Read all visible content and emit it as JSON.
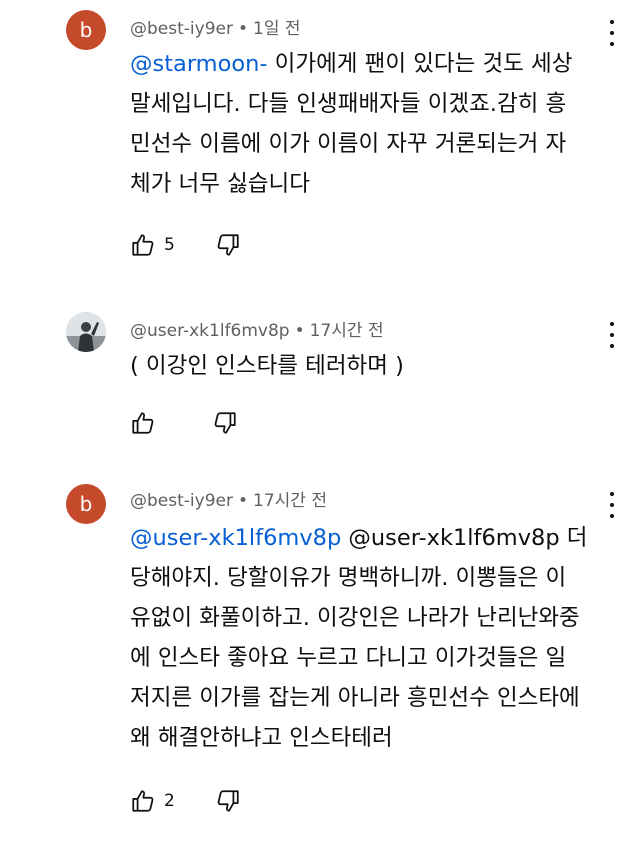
{
  "comments": [
    {
      "avatar_letter": "b",
      "author": "@best-iy9er",
      "separator": "•",
      "time": "1일 전",
      "lines": [
        {
          "mention": "@starmoon-",
          "text": " 이가에게 팬이 있다는 것도 세상"
        },
        {
          "mention": "",
          "text": "말세입니다. 다들  인생패배자들 이겠죠.감히 흥"
        },
        {
          "mention": "",
          "text": "민선수 이름에 이가 이름이 자꾸 거론되는거 자"
        },
        {
          "mention": "",
          "text": "체가 너무 싫습니다"
        }
      ],
      "like_count": "5",
      "avatar_color": "#c54a2c"
    },
    {
      "avatar_letter": "",
      "author": "@user-xk1lf6mv8p",
      "separator": "•",
      "time": "17시간 전",
      "lines": [
        {
          "mention": "",
          "text": "( 이강인 인스타를 테러하며 )"
        }
      ],
      "like_count": ""
    },
    {
      "avatar_letter": "b",
      "author": "@best-iy9er",
      "separator": "•",
      "time": "17시간 전",
      "lines": [
        {
          "mention": "@user-xk1lf6mv8p",
          "text": "  @user-xk1lf6mv8p  더"
        },
        {
          "mention": "",
          "text": "당해야지. 당할이유가 명백하니까. 이뽕들은 이"
        },
        {
          "mention": "",
          "text": "유없이 화풀이하고. 이강인은 나라가 난리난와중"
        },
        {
          "mention": "",
          "text": "에 인스타 좋아요 누르고 다니고  이가것들은 일"
        },
        {
          "mention": "",
          "text": "저지른 이가를 잡는게 아니라 흥민선수 인스타에"
        },
        {
          "mention": "",
          "text": "왜 해결안하냐고 인스타테러"
        }
      ],
      "like_count": "2",
      "avatar_color": "#c54a2c"
    }
  ],
  "icons": {
    "like": "thumbs-up-icon",
    "dislike": "thumbs-down-icon",
    "more": "more-vert-icon"
  },
  "colors": {
    "mention": "#065fd4",
    "meta": "#606060",
    "text": "#0f0f0f"
  }
}
